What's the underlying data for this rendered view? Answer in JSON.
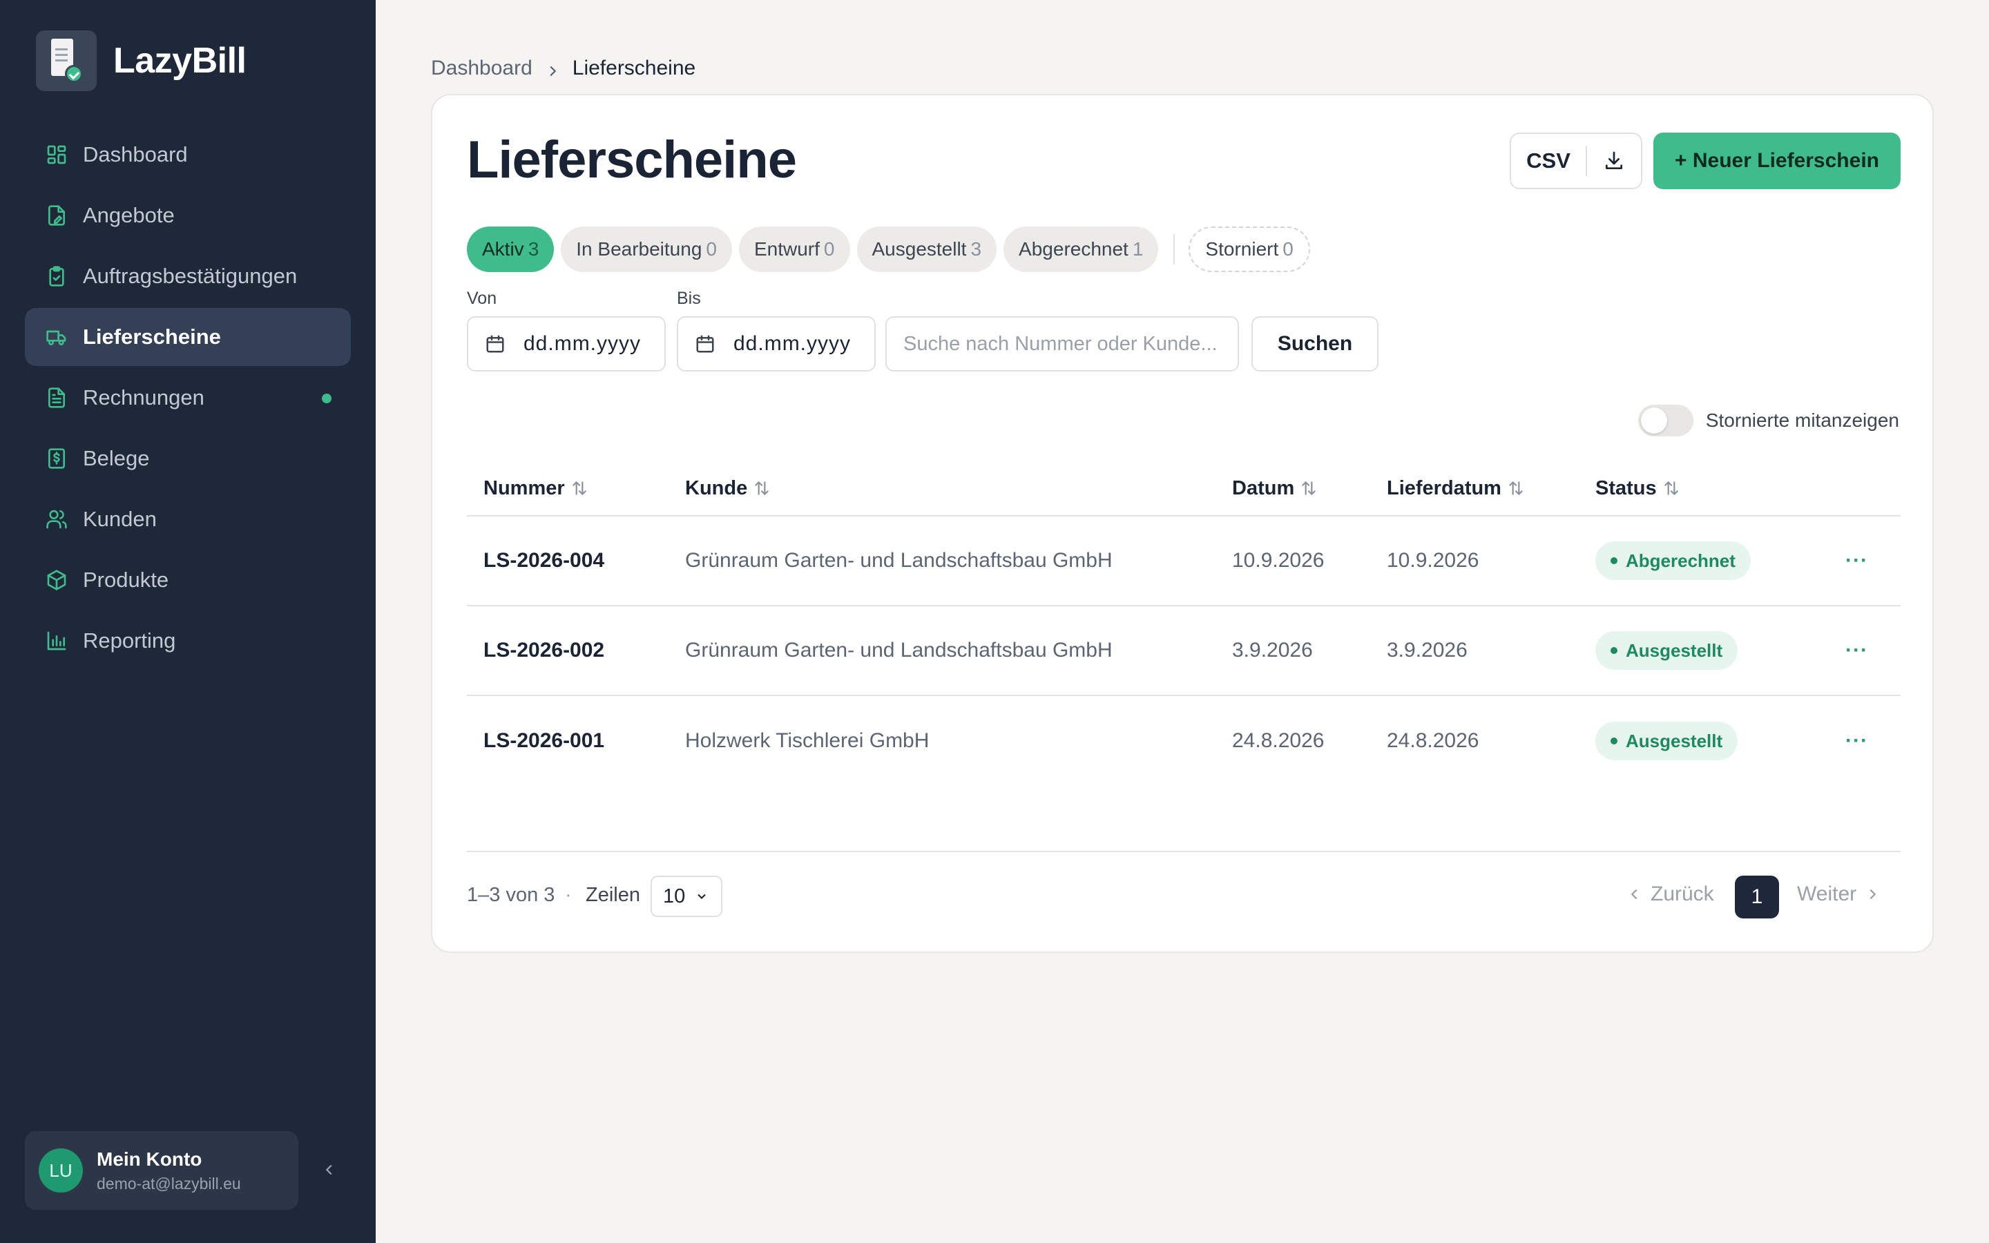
{
  "brand": {
    "name": "LazyBill"
  },
  "colors": {
    "sidebar_bg": "#1e2838",
    "accent": "#3ebc8c",
    "status_bg": "#e6f6ee",
    "status_text": "#1e8a5f"
  },
  "sidebar": {
    "items": [
      {
        "label": "Dashboard",
        "icon": "dashboard-icon"
      },
      {
        "label": "Angebote",
        "icon": "file-edit-icon"
      },
      {
        "label": "Auftragsbestätigungen",
        "icon": "clipboard-check-icon"
      },
      {
        "label": "Lieferscheine",
        "icon": "truck-icon",
        "active": true
      },
      {
        "label": "Rechnungen",
        "icon": "file-text-icon",
        "badge_dot": true
      },
      {
        "label": "Belege",
        "icon": "receipt-dollar-icon"
      },
      {
        "label": "Kunden",
        "icon": "users-icon"
      },
      {
        "label": "Produkte",
        "icon": "package-icon"
      },
      {
        "label": "Reporting",
        "icon": "bar-chart-icon"
      }
    ],
    "account": {
      "initials": "LU",
      "name": "Mein Konto",
      "email": "demo-at@lazybill.eu"
    }
  },
  "breadcrumb": {
    "parent": "Dashboard",
    "current": "Lieferscheine"
  },
  "page": {
    "title": "Lieferscheine",
    "csv_label": "CSV",
    "new_button": "+ Neuer Lieferschein"
  },
  "tabs": [
    {
      "label": "Aktiv",
      "count": "3",
      "active": true
    },
    {
      "label": "In Bearbeitung",
      "count": "0"
    },
    {
      "label": "Entwurf",
      "count": "0"
    },
    {
      "label": "Ausgestellt",
      "count": "3"
    },
    {
      "label": "Abgerechnet",
      "count": "1"
    },
    {
      "label": "Storniert",
      "count": "0"
    }
  ],
  "filters": {
    "from_label": "Von",
    "to_label": "Bis",
    "from_value": "dd.mm.yyyy",
    "to_value": "dd.mm.yyyy",
    "search_placeholder": "Suche nach Nummer oder Kunde...",
    "search_button": "Suchen",
    "toggle_label": "Stornierte mitanzeigen"
  },
  "table": {
    "headers": {
      "number": "Nummer",
      "customer": "Kunde",
      "date": "Datum",
      "delivery_date": "Lieferdatum",
      "status": "Status"
    },
    "rows": [
      {
        "number": "LS-2026-004",
        "customer": "Grünraum Garten- und Landschaftsbau GmbH",
        "date": "10.9.2026",
        "delivery_date": "10.9.2026",
        "status": "Abgerechnet",
        "actions": "···"
      },
      {
        "number": "LS-2026-002",
        "customer": "Grünraum Garten- und Landschaftsbau GmbH",
        "date": "3.9.2026",
        "delivery_date": "3.9.2026",
        "status": "Ausgestellt",
        "actions": "···"
      },
      {
        "number": "LS-2026-001",
        "customer": "Holzwerk Tischlerei GmbH",
        "date": "24.8.2026",
        "delivery_date": "24.8.2026",
        "status": "Ausgestellt",
        "actions": "···"
      }
    ]
  },
  "pagination": {
    "range": "1–3 von 3",
    "separator": "·",
    "rows_label": "Zeilen",
    "rows_value": "10",
    "prev": "Zurück",
    "page": "1",
    "next": "Weiter"
  }
}
